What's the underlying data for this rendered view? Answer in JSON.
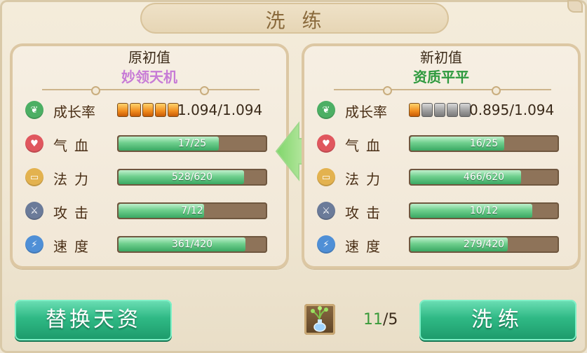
{
  "title": "洗练",
  "left_panel": {
    "heading": "原初值",
    "subtitle": "妙领天机",
    "subtitle_color": "#c77bd6",
    "growth": {
      "label": "成长率",
      "pips_on": 5,
      "pips_total": 5,
      "value": "1.094/1.094"
    },
    "stats": [
      {
        "label": "气血",
        "text": "17/25",
        "fraction": 0.68,
        "icon": "heart-icon"
      },
      {
        "label": "法力",
        "text": "528/620",
        "fraction": 0.85,
        "icon": "scroll-icon"
      },
      {
        "label": "攻击",
        "text": "7/12",
        "fraction": 0.58,
        "icon": "sword-icon"
      },
      {
        "label": "速度",
        "text": "361/420",
        "fraction": 0.86,
        "icon": "lightning-icon"
      }
    ]
  },
  "right_panel": {
    "heading": "新初值",
    "subtitle": "资质平平",
    "subtitle_color": "#2e9a3e",
    "growth": {
      "label": "成长率",
      "pips_on": 1,
      "pips_total": 5,
      "value": "0.895/1.094"
    },
    "stats": [
      {
        "label": "气血",
        "text": "16/25",
        "fraction": 0.64,
        "icon": "heart-icon"
      },
      {
        "label": "法力",
        "text": "466/620",
        "fraction": 0.75,
        "icon": "scroll-icon"
      },
      {
        "label": "攻击",
        "text": "10/12",
        "fraction": 0.83,
        "icon": "sword-icon"
      },
      {
        "label": "速度",
        "text": "279/420",
        "fraction": 0.66,
        "icon": "lightning-icon"
      }
    ]
  },
  "buttons": {
    "replace": "替换天资",
    "refine": "洗练"
  },
  "item": {
    "icon": "potion-icon",
    "have": "11",
    "sep": "/",
    "need": "5"
  }
}
